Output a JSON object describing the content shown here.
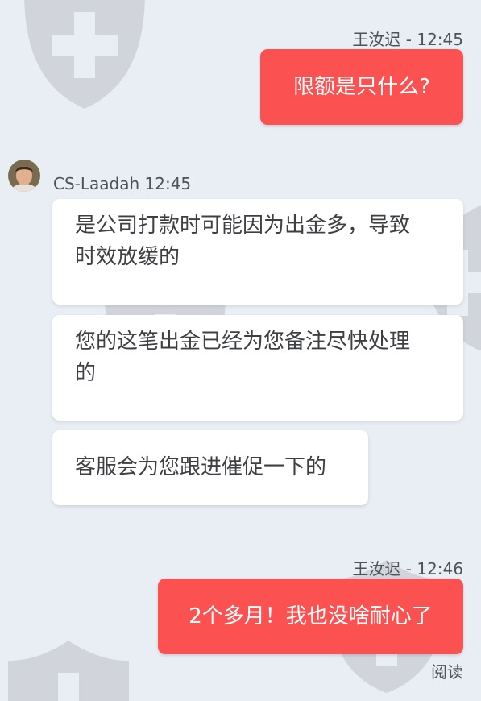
{
  "messages": {
    "m1": {
      "sender_time": "王汝迟 - 12:45",
      "text": "限额是只什么?"
    },
    "agent": {
      "name_time": "CS-Laadah 12:45",
      "avatar_icon": "agent-avatar"
    },
    "m2": {
      "line1": "是公司打款时可能因为出金多，导致",
      "line2": "时效放缓的"
    },
    "m3": {
      "line1": "您的这笔出金已经为您备注尽快处理",
      "line2": "的"
    },
    "m4": {
      "text": "客服会为您跟进催促一下的"
    },
    "m5": {
      "sender_time": "王汝迟 - 12:46",
      "text": "2个多月！我也没啥耐心了"
    },
    "read_status": "阅读"
  },
  "colors": {
    "background": "#e9edf4",
    "outgoing": "#fb5150",
    "incoming": "#ffffff",
    "watermark": "#c9ccd1"
  }
}
